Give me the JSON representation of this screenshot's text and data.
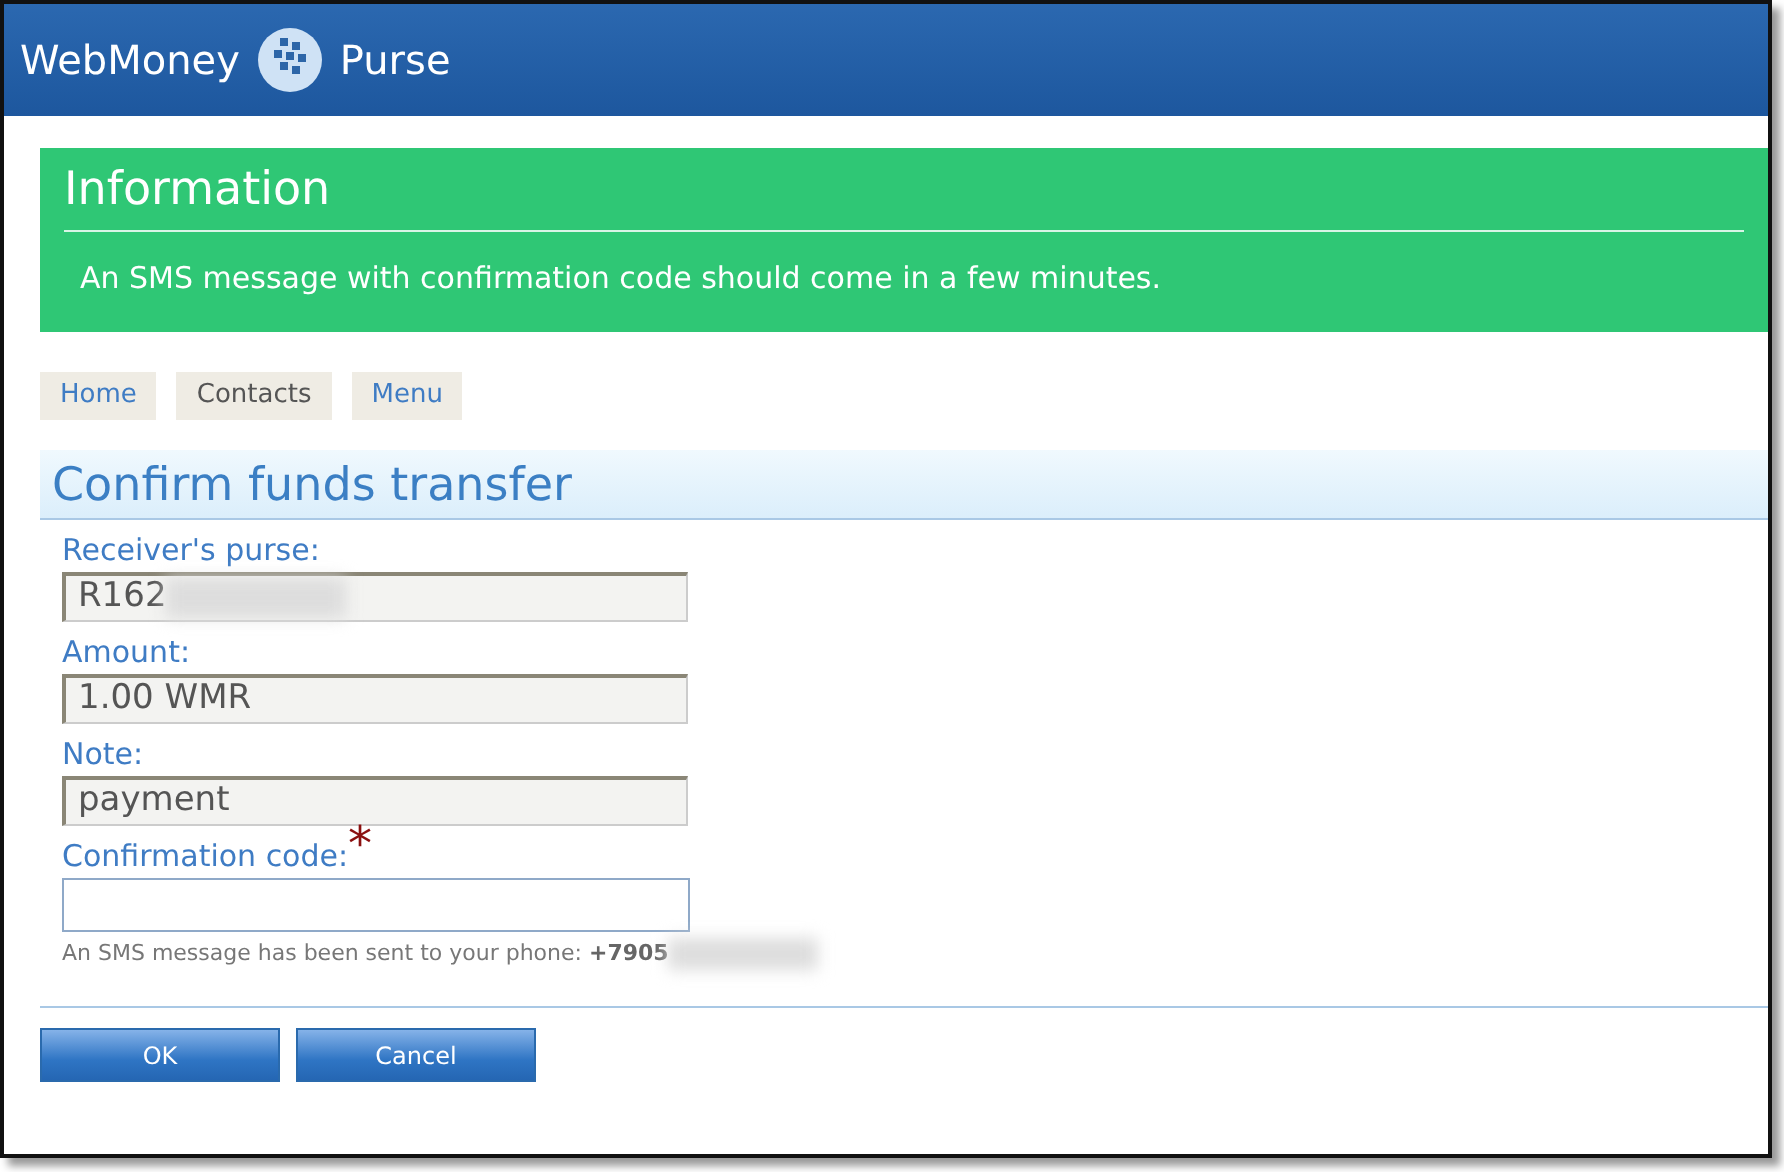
{
  "header": {
    "brand": "WebMoney",
    "product": "Purse"
  },
  "info": {
    "title": "Information",
    "message": "An SMS message with confirmation code should come in a few minutes."
  },
  "nav": [
    {
      "label": "Home",
      "selected": false
    },
    {
      "label": "Contacts",
      "selected": true
    },
    {
      "label": "Menu",
      "selected": false
    }
  ],
  "form": {
    "title": "Confirm funds transfer",
    "fields": [
      {
        "kind": "readonly",
        "label": "Receiver's purse:",
        "value": "R162",
        "redacted": true,
        "required": false
      },
      {
        "kind": "readonly",
        "label": "Amount:",
        "value": "1.00 WMR",
        "redacted": false,
        "required": false
      },
      {
        "kind": "readonly",
        "label": "Note:",
        "value": "payment",
        "redacted": false,
        "required": false
      },
      {
        "kind": "input",
        "label": "Confirmation code:",
        "redacted": false,
        "required": true,
        "required_mark": "*"
      }
    ],
    "hint": "An SMS message has been sent to your phone: **+7905**",
    "hint_redacted": true
  },
  "buttons": [
    "OK",
    "Cancel"
  ]
}
